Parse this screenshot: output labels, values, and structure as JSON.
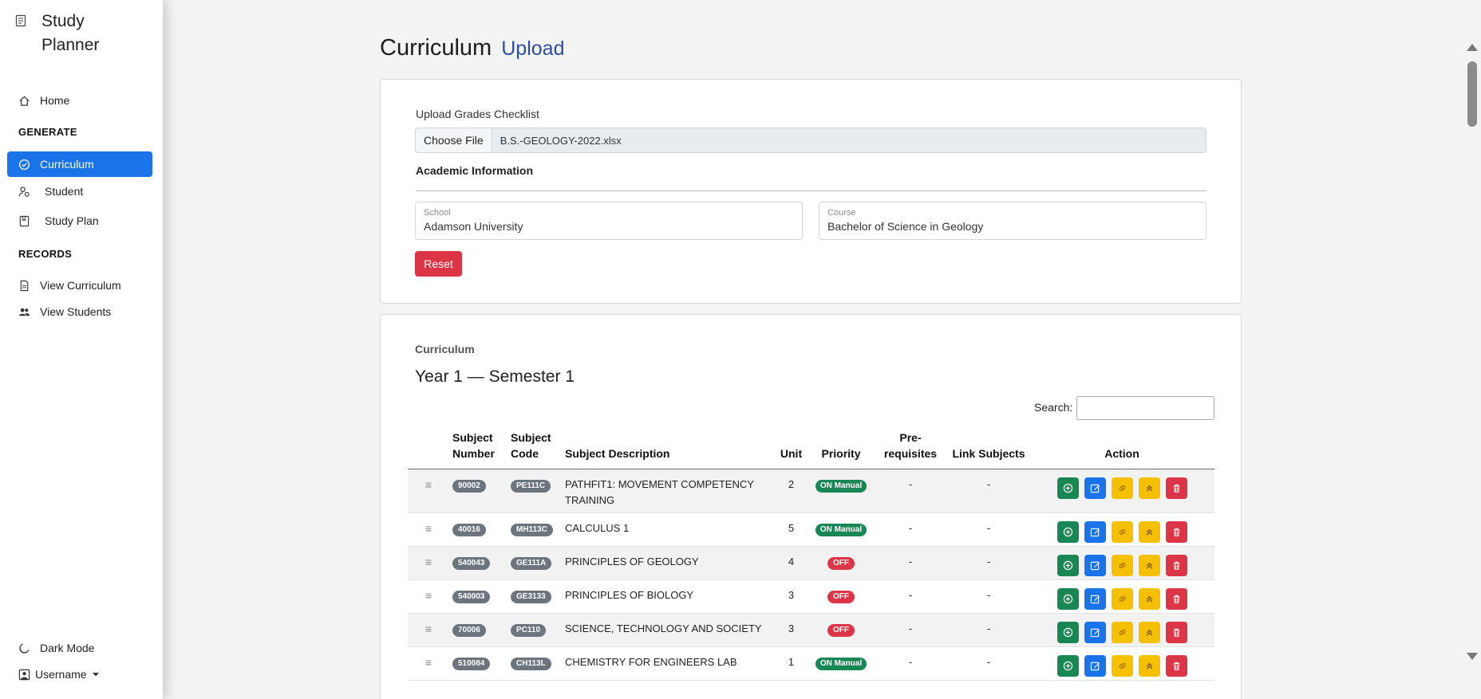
{
  "sidebar": {
    "brand": "Study Planner",
    "nav": {
      "home": "Home",
      "generate_head": "GENERATE",
      "curriculum": "Curriculum",
      "student": "Student",
      "study_plan": "Study Plan",
      "records_head": "RECORDS",
      "view_curriculum": "View Curriculum",
      "view_students": "View Students"
    },
    "dark_mode": "Dark Mode",
    "username": "Username"
  },
  "page": {
    "title": "Curriculum",
    "title_accent": "Upload"
  },
  "upload": {
    "label": "Upload Grades Checklist",
    "choose_file": "Choose File",
    "file_name": "B.S.-GEOLOGY-2022.xlsx",
    "academic_head": "Academic Information",
    "school_label": "School",
    "school_value": "Adamson University",
    "course_label": "Course",
    "course_value": "Bachelor of Science in Geology",
    "reset": "Reset"
  },
  "curriculum": {
    "label": "Curriculum",
    "semester": "Year 1 — Semester 1",
    "search_label": "Search:",
    "headers": {
      "subject_number": "Subject Number",
      "subject_code": "Subject Code",
      "subject_description": "Subject Description",
      "unit": "Unit",
      "priority": "Priority",
      "prerequisites": "Pre-requisites",
      "link_subjects": "Link Subjects",
      "action": "Action"
    },
    "rows": [
      {
        "number": "90002",
        "code": "PE111C",
        "description": "PATHFIT1: MOVEMENT COMPETENCY TRAINING",
        "unit": "2",
        "priority": "ON Manual",
        "prereq": "-",
        "link": "-"
      },
      {
        "number": "40016",
        "code": "MH113C",
        "description": "CALCULUS 1",
        "unit": "5",
        "priority": "ON Manual",
        "prereq": "-",
        "link": "-"
      },
      {
        "number": "540043",
        "code": "GE111A",
        "description": "PRINCIPLES OF GEOLOGY",
        "unit": "4",
        "priority": "OFF",
        "prereq": "-",
        "link": "-"
      },
      {
        "number": "540003",
        "code": "GE3133",
        "description": "PRINCIPLES OF BIOLOGY",
        "unit": "3",
        "priority": "OFF",
        "prereq": "-",
        "link": "-"
      },
      {
        "number": "70006",
        "code": "PC110",
        "description": "SCIENCE, TECHNOLOGY AND SOCIETY",
        "unit": "3",
        "priority": "OFF",
        "prereq": "-",
        "link": "-"
      },
      {
        "number": "510084",
        "code": "CH113L",
        "description": "CHEMISTRY FOR ENGINEERS LAB",
        "unit": "1",
        "priority": "ON Manual",
        "prereq": "-",
        "link": "-"
      }
    ]
  },
  "colors": {
    "accent": "#1a73e8",
    "success": "#198754",
    "danger": "#dc3545",
    "warning": "#f5c000",
    "title_accent": "#2a4f9e"
  },
  "icons": {
    "action_buttons": [
      "plus-circle-icon",
      "edit-icon",
      "link-icon",
      "chevrons-up-icon",
      "trash-icon"
    ]
  }
}
